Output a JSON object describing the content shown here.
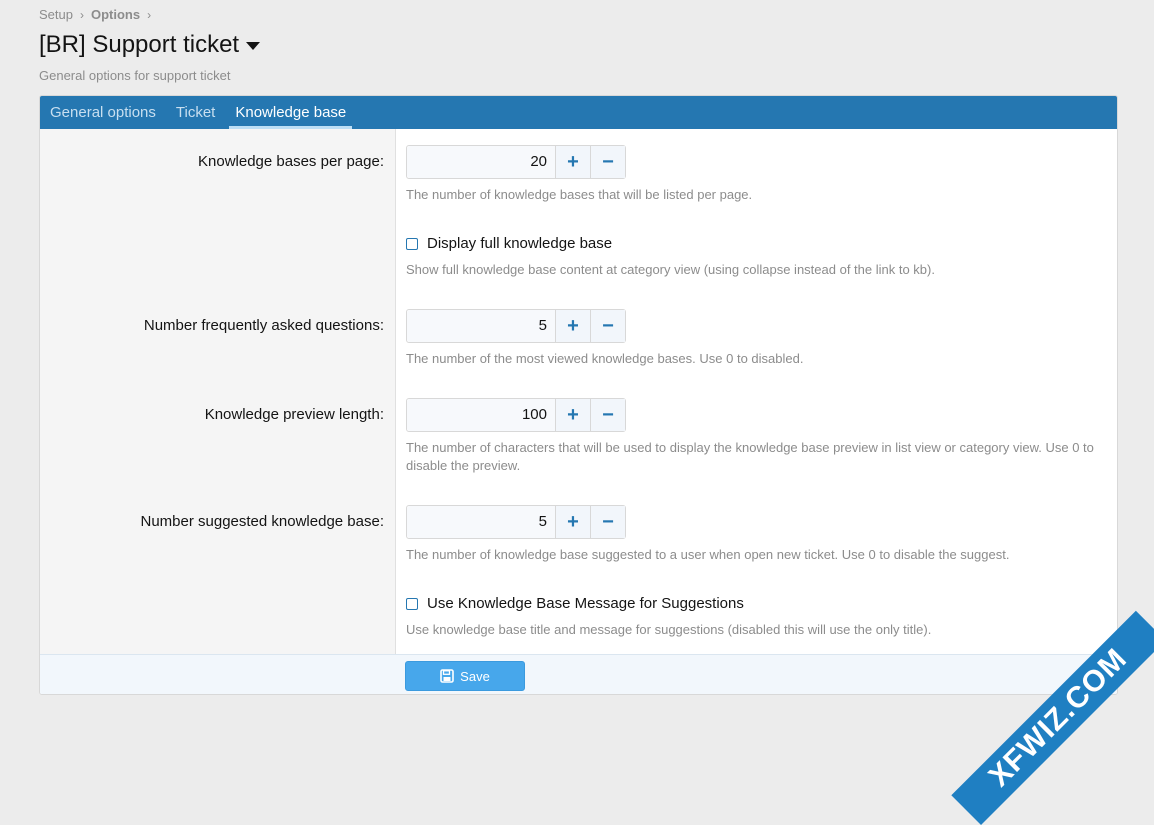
{
  "breadcrumb": {
    "item1": "Setup",
    "item2": "Options",
    "sep": "›"
  },
  "title": "[BR] Support ticket",
  "subtitle": "General options for support ticket",
  "tabs": [
    {
      "label": "General options"
    },
    {
      "label": "Ticket"
    },
    {
      "label": "Knowledge base"
    }
  ],
  "options": {
    "per_page": {
      "label": "Knowledge bases per page:",
      "value": "20",
      "hint": "The number of knowledge bases that will be listed per page."
    },
    "display_full": {
      "label": "Display full knowledge base",
      "checked": false,
      "hint": "Show full knowledge base content at category view (using collapse instead of the link to kb)."
    },
    "faq": {
      "label": "Number frequently asked questions:",
      "value": "5",
      "hint": "The number of the most viewed knowledge bases. Use 0 to disabled."
    },
    "preview": {
      "label": "Knowledge preview length:",
      "value": "100",
      "hint": "The number of characters that will be used to display the knowledge base preview in list view or category view. Use 0 to disable the preview."
    },
    "suggested": {
      "label": "Number suggested knowledge base:",
      "value": "5",
      "hint": "The number of knowledge base suggested to a user when open new ticket. Use 0 to disable the suggest."
    },
    "use_message": {
      "label": "Use Knowledge Base Message for Suggestions",
      "checked": false,
      "hint": "Use knowledge base title and message for suggestions (disabled this will use the only title)."
    }
  },
  "stepper": {
    "plus": "+",
    "minus": "−"
  },
  "save_label": "Save",
  "watermark": "XFWIZ.COM",
  "colors": {
    "accent": "#2577b1",
    "button": "#47a7eb"
  }
}
